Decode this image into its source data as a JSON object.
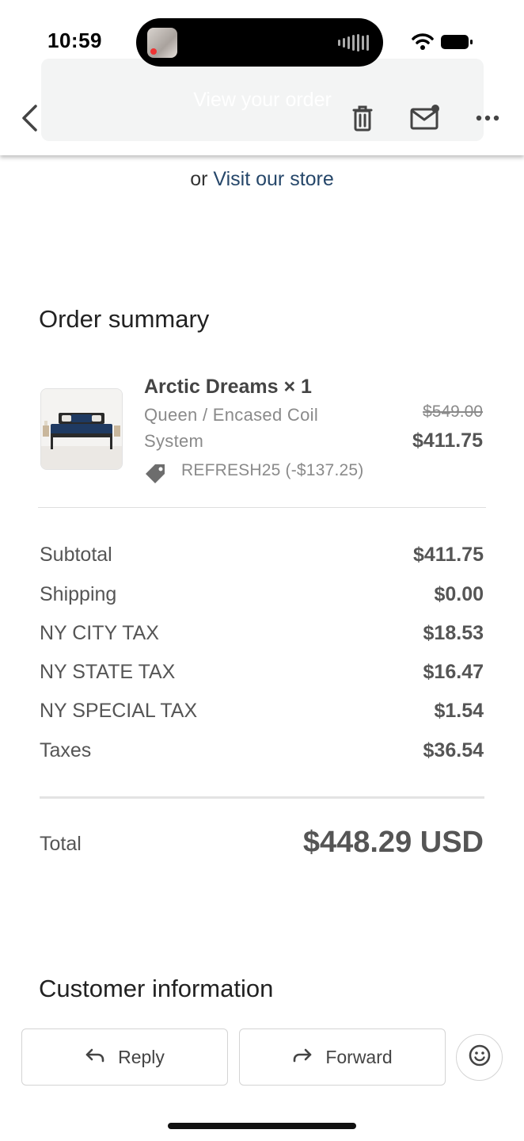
{
  "status_bar": {
    "time": "10:59"
  },
  "header": {
    "ghost_title": "View your order"
  },
  "store_line": {
    "prefix": "or",
    "link": "Visit our store"
  },
  "order_summary": {
    "heading": "Order summary",
    "item": {
      "title": "Arctic Dreams × 1",
      "variant_line1": "Queen / Encased Coil",
      "variant_line2": "System",
      "discount": "REFRESH25 (-$137.25)",
      "original_price": "$549.00",
      "price": "$411.75"
    },
    "rows": [
      {
        "label": "Subtotal",
        "value": "$411.75"
      },
      {
        "label": "Shipping",
        "value": "$0.00"
      },
      {
        "label": "NY CITY TAX",
        "value": "$18.53"
      },
      {
        "label": "NY STATE TAX",
        "value": "$16.47"
      },
      {
        "label": "NY SPECIAL TAX",
        "value": "$1.54"
      },
      {
        "label": "Taxes",
        "value": "$36.54"
      }
    ],
    "total_label": "Total",
    "total_value": "$448.29 USD"
  },
  "customer": {
    "heading": "Customer information"
  },
  "actions": {
    "reply": "Reply",
    "forward": "Forward"
  },
  "colors": {
    "link": "#26476a",
    "text": "#222222",
    "muted": "#555555"
  }
}
